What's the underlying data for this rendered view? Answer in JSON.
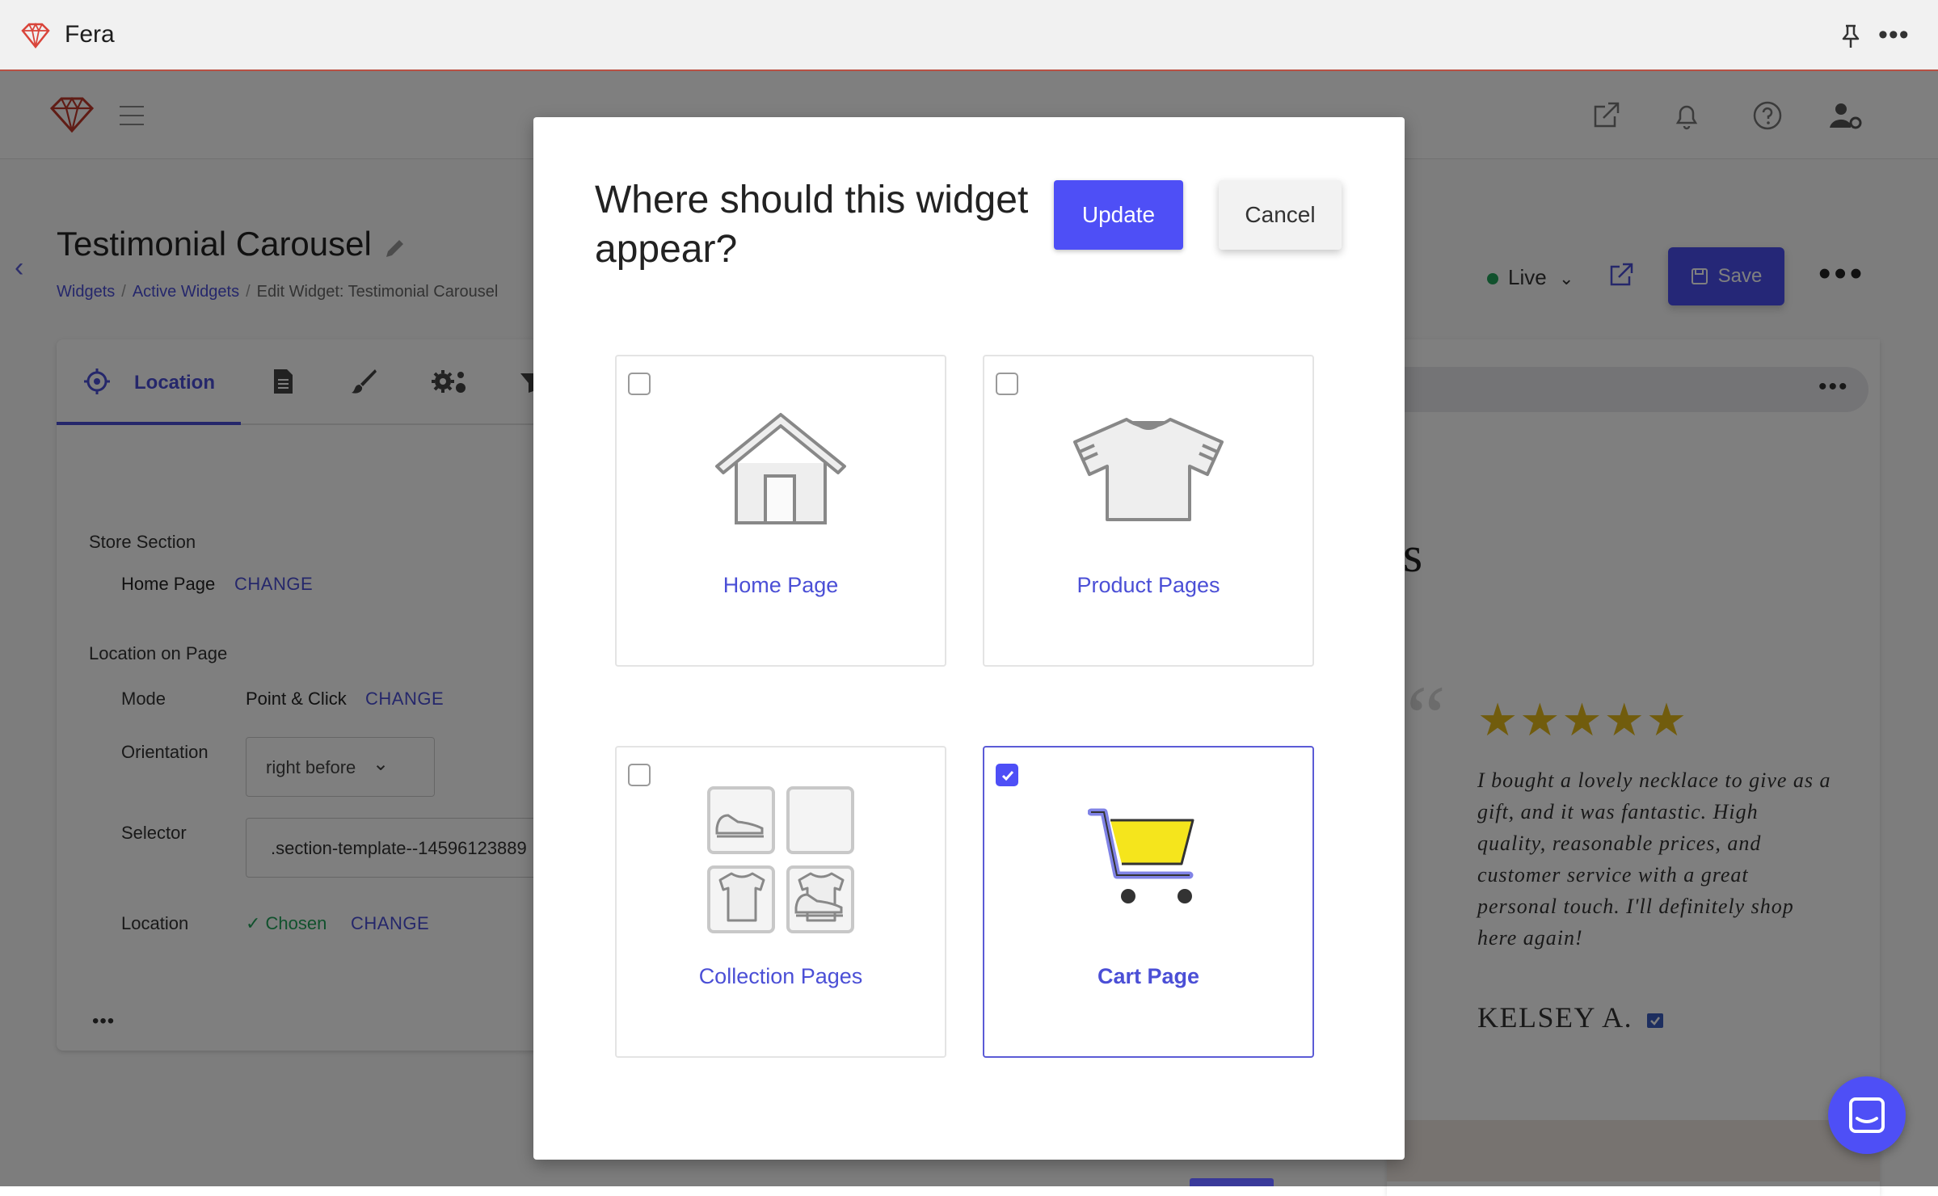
{
  "window": {
    "app_name": "Fera",
    "more_label": "•••"
  },
  "header": {
    "title": "Testimonial Carousel",
    "breadcrumb": [
      "Widgets",
      "Active Widgets",
      "Edit Widget: Testimonial Carousel"
    ],
    "status": "Live",
    "save_label": "Save",
    "more_label": "•••"
  },
  "location_panel": {
    "active_tab": "Location",
    "store_section_label": "Store Section",
    "store_section_value": "Home Page",
    "change_label": "CHANGE",
    "location_on_page_label": "Location on Page",
    "mode_label": "Mode",
    "mode_value": "Point & Click",
    "orientation_label": "Orientation",
    "orientation_value": "right before",
    "selector_label": "Selector",
    "selector_value": ".section-template--14596123889",
    "location_label": "Location",
    "location_value": "Chosen",
    "more_label": "•••"
  },
  "preview": {
    "more_label": "•••",
    "partial_heading": "s",
    "quote_mark": "“",
    "stars": "★★★★★",
    "rating": 5,
    "review": "I bought a lovely necklace to give as a gift, and it was fantastic. High quality, reasonable prices, and customer service with a great personal touch. I'll definitely shop here again!",
    "reviewer": "KELSEY A."
  },
  "modal": {
    "title": "Where should this widget appear?",
    "update_label": "Update",
    "cancel_label": "Cancel",
    "options": [
      {
        "label": "Home Page",
        "icon": "house-icon",
        "checked": false
      },
      {
        "label": "Product Pages",
        "icon": "tshirt-icon",
        "checked": false
      },
      {
        "label": "Collection Pages",
        "icon": "collection-grid-icon",
        "checked": false
      },
      {
        "label": "Cart Page",
        "icon": "shopping-cart-icon",
        "checked": true
      }
    ]
  },
  "colors": {
    "accent": "#4e4ff6",
    "success": "#22a35a",
    "stars": "#e2b81a",
    "brand": "#c0392b"
  }
}
